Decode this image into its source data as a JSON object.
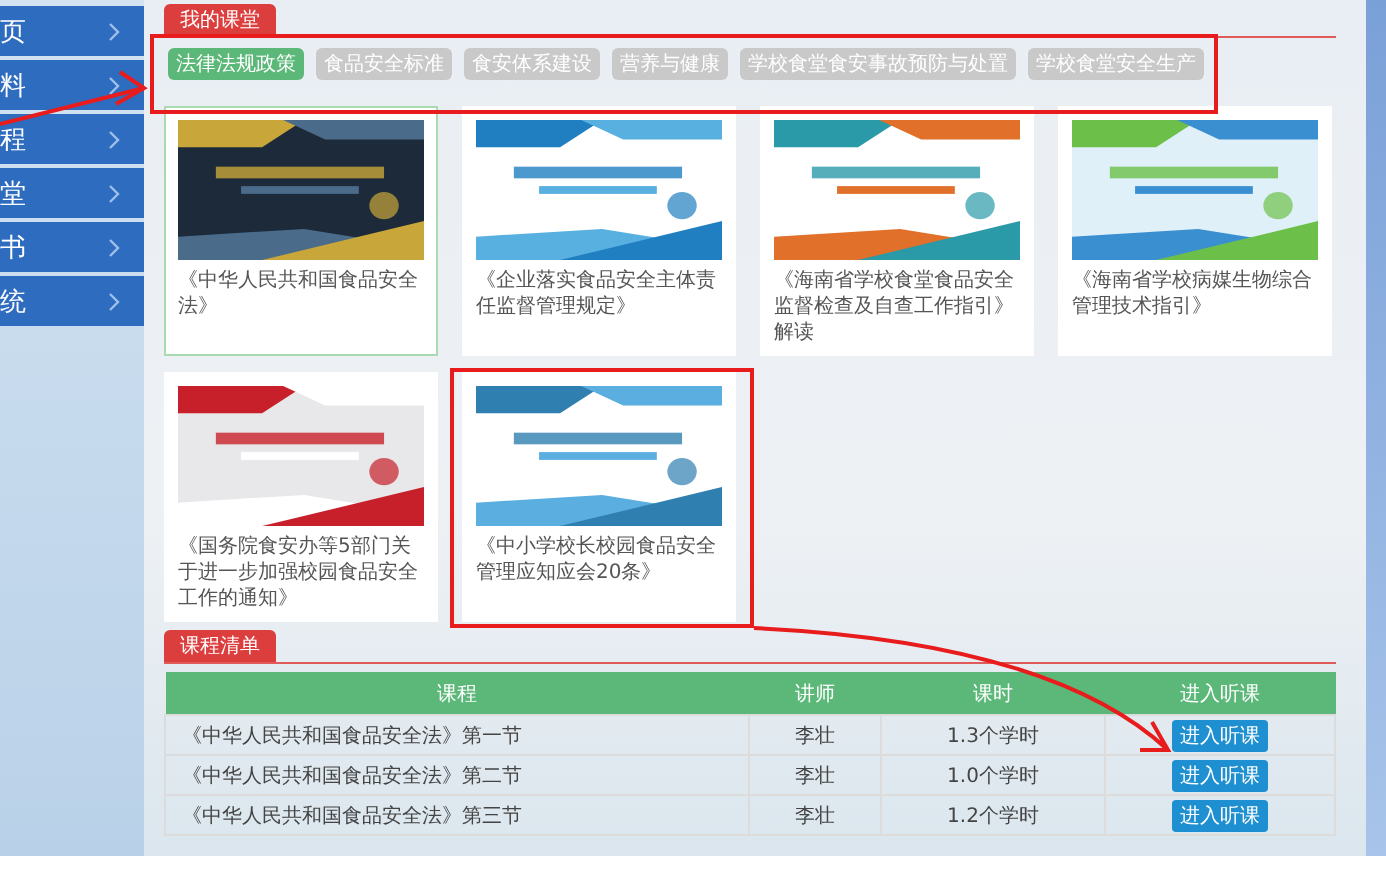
{
  "sidebar": {
    "items": [
      {
        "label": "页"
      },
      {
        "label": "料"
      },
      {
        "label": "程"
      },
      {
        "label": "堂"
      },
      {
        "label": "书"
      },
      {
        "label": "统"
      }
    ]
  },
  "classroom": {
    "title": "我的课堂",
    "tabs": [
      {
        "label": "法律法规政策",
        "selected": true
      },
      {
        "label": "食品安全标准",
        "selected": false
      },
      {
        "label": "食安体系建设",
        "selected": false
      },
      {
        "label": "营养与健康",
        "selected": false
      },
      {
        "label": "学校食堂食安事故预防与处置",
        "selected": false
      },
      {
        "label": "学校食堂安全生产",
        "selected": false
      }
    ],
    "courses": [
      {
        "title": "《中华人民共和国食品安全法》",
        "selected": true
      },
      {
        "title": "《企业落实食品安全主体责任监督管理规定》",
        "selected": false
      },
      {
        "title": "《海南省学校食堂食品安全监督检查及自查工作指引》解读",
        "selected": false
      },
      {
        "title": "《海南省学校病媒生物综合管理技术指引》",
        "selected": false
      },
      {
        "title": "《国务院食安办等5部门关于进一步加强校园食品安全工作的通知》",
        "selected": false
      },
      {
        "title": "《中小学校长校园食品安全管理应知应会20条》",
        "selected": false
      }
    ]
  },
  "course_list": {
    "title": "课程清单",
    "columns": [
      "课程",
      "讲师",
      "课时",
      "进入听课"
    ],
    "rows": [
      {
        "course": "《中华人民共和国食品安全法》第一节",
        "lecturer": "李壮",
        "hours": "1.3个学时",
        "action": "进入听课"
      },
      {
        "course": "《中华人民共和国食品安全法》第二节",
        "lecturer": "李壮",
        "hours": "1.0个学时",
        "action": "进入听课"
      },
      {
        "course": "《中华人民共和国食品安全法》第三节",
        "lecturer": "李壮",
        "hours": "1.2个学时",
        "action": "进入听课"
      }
    ]
  }
}
